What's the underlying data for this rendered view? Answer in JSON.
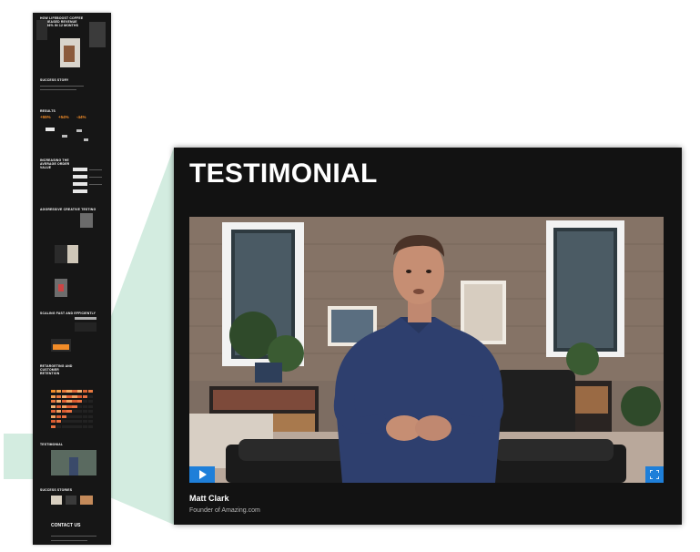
{
  "thumbnail": {
    "headline": "HOW LIFEBOOST COFFEE INCREASED REVENUE 143.86% IN 12 MONTHS",
    "sections": [
      "SUCCESS STORY",
      "RESULTS",
      "INCREASING THE AVERAGE ORDER VALUE",
      "AGGRESSIVE CREATIVE TESTING",
      "SCALING FAST AND EFFICIENTLY",
      "RETARGETING AND CUSTOMER RETENTION",
      "TESTIMONIAL",
      "SUCCESS STORIES"
    ],
    "stats": [
      "+55%",
      "+54%",
      "-44%"
    ],
    "contact": "CONTACT US"
  },
  "panel": {
    "title": "TESTIMONIAL",
    "video": {
      "play_icon": "play-icon",
      "fullscreen_icon": "fullscreen-icon"
    },
    "person_name": "Matt Clark",
    "person_role": "Founder of Amazing.com"
  },
  "colors": {
    "panel_bg": "#121212",
    "accent_blue": "#1e7fd9",
    "stat_orange": "#f28c28",
    "connector_green": "#d3ece0"
  }
}
